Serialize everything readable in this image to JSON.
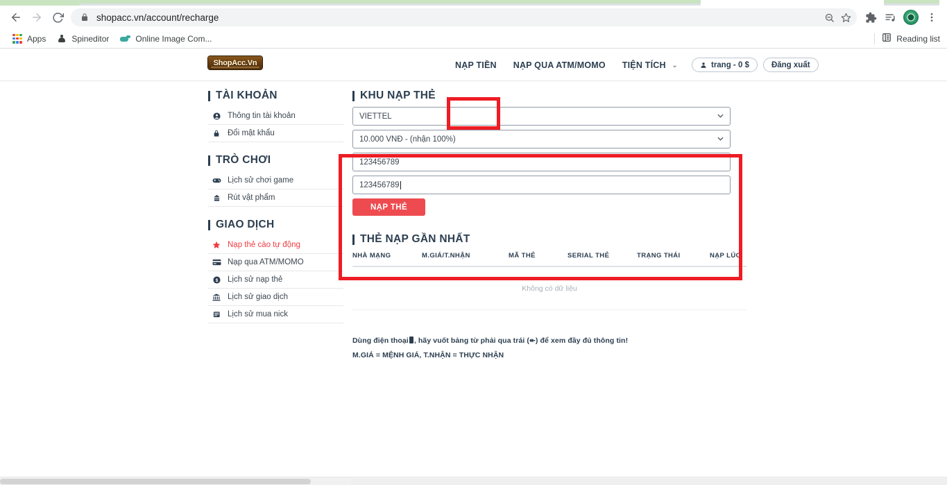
{
  "browser": {
    "url": "shopacc.vn/account/recharge",
    "back_label": "Back",
    "forward_label": "Forward",
    "reload_label": "Reload",
    "lock_icon": "lock-icon",
    "zoom_icon": "zoom-out-icon",
    "bookmark_icon": "star-icon",
    "extensions_icon": "puzzle-icon",
    "media_icon": "media-list-icon",
    "profile_icon": "avatar-icon",
    "menu_icon": "three-dot-menu-icon",
    "bookmarks": [
      {
        "label": "Apps",
        "icon": "apps-grid-icon"
      },
      {
        "label": "Spineditor",
        "icon": "spineditor-icon"
      },
      {
        "label": "Online Image Com...",
        "icon": "online-image-compressor-icon"
      }
    ],
    "reading_list": "Reading list",
    "reading_list_icon": "reading-list-icon"
  },
  "site": {
    "logo_text": "ShopAcc.Vn",
    "nav": [
      {
        "label": "NẠP TIỀN",
        "highlighted": true
      },
      {
        "label": "NẠP QUA ATM/MOMO",
        "highlighted": false
      },
      {
        "label": "TIỆN TÍCH",
        "caret": "⌄",
        "highlighted": false
      }
    ],
    "user_pill": "trang - 0 $",
    "logout": "Đăng xuất"
  },
  "sidebar": {
    "sections": [
      {
        "title": "TÀI KHOẢN",
        "items": [
          {
            "label": "Thông tin tài khoản",
            "icon": "user-circle-icon",
            "active": false
          },
          {
            "label": "Đổi mật khẩu",
            "icon": "lock-icon",
            "active": false
          }
        ]
      },
      {
        "title": "TRÒ CHƠI",
        "items": [
          {
            "label": "Lịch sử chơi game",
            "icon": "gamepad-icon",
            "active": false
          },
          {
            "label": "Rút vật phẩm",
            "icon": "download-item-icon",
            "active": false
          }
        ]
      },
      {
        "title": "GIAO DỊCH",
        "items": [
          {
            "label": "Nạp thẻ cào tự động",
            "icon": "star-icon",
            "active": true
          },
          {
            "label": "Nạp qua ATM/MOMO",
            "icon": "credit-card-icon",
            "active": false
          },
          {
            "label": "Lịch sử nạp thẻ",
            "icon": "dollar-circle-icon",
            "active": false
          },
          {
            "label": "Lịch sử giao dịch",
            "icon": "bank-icon",
            "active": false
          },
          {
            "label": "Lịch sử mua nick",
            "icon": "list-icon",
            "active": false
          }
        ]
      }
    ]
  },
  "recharge": {
    "title": "KHU NẠP THẺ",
    "carrier_select": {
      "value": "VIETTEL",
      "caret_icon": "chevron-down-icon"
    },
    "amount_select": {
      "value": "10.000 VNĐ - (nhận 100%)",
      "caret_icon": "chevron-down-icon"
    },
    "card_code_input": {
      "value": "123456789"
    },
    "card_serial_input": {
      "value": "123456789"
    },
    "submit_button": "NẠP THẺ"
  },
  "recent": {
    "title": "THẺ NẠP GẦN NHẤT",
    "columns": [
      "NHÀ MẠNG",
      "M.GIÁ/T.NHẬN",
      "MÃ THẺ",
      "SERIAL THẺ",
      "TRẠNG THÁI",
      "NẠP LÚC"
    ],
    "empty_message": "Không có dữ liệu",
    "rows": []
  },
  "notes": {
    "line1_a": "Dùng điện thoại",
    "line1_b": ", hãy vuốt bảng từ phải qua trái (↞) để xem đầy đủ thông tin!",
    "line2": "M.GIÁ = MỆNH GIÁ, T.NHẬN = THỰC NHẬN"
  },
  "colors": {
    "accent_red": "#ee4b50",
    "annotation_red": "#ee1c24",
    "heading": "#2c3e50",
    "tabstrip_green": "#c9e4c0"
  }
}
